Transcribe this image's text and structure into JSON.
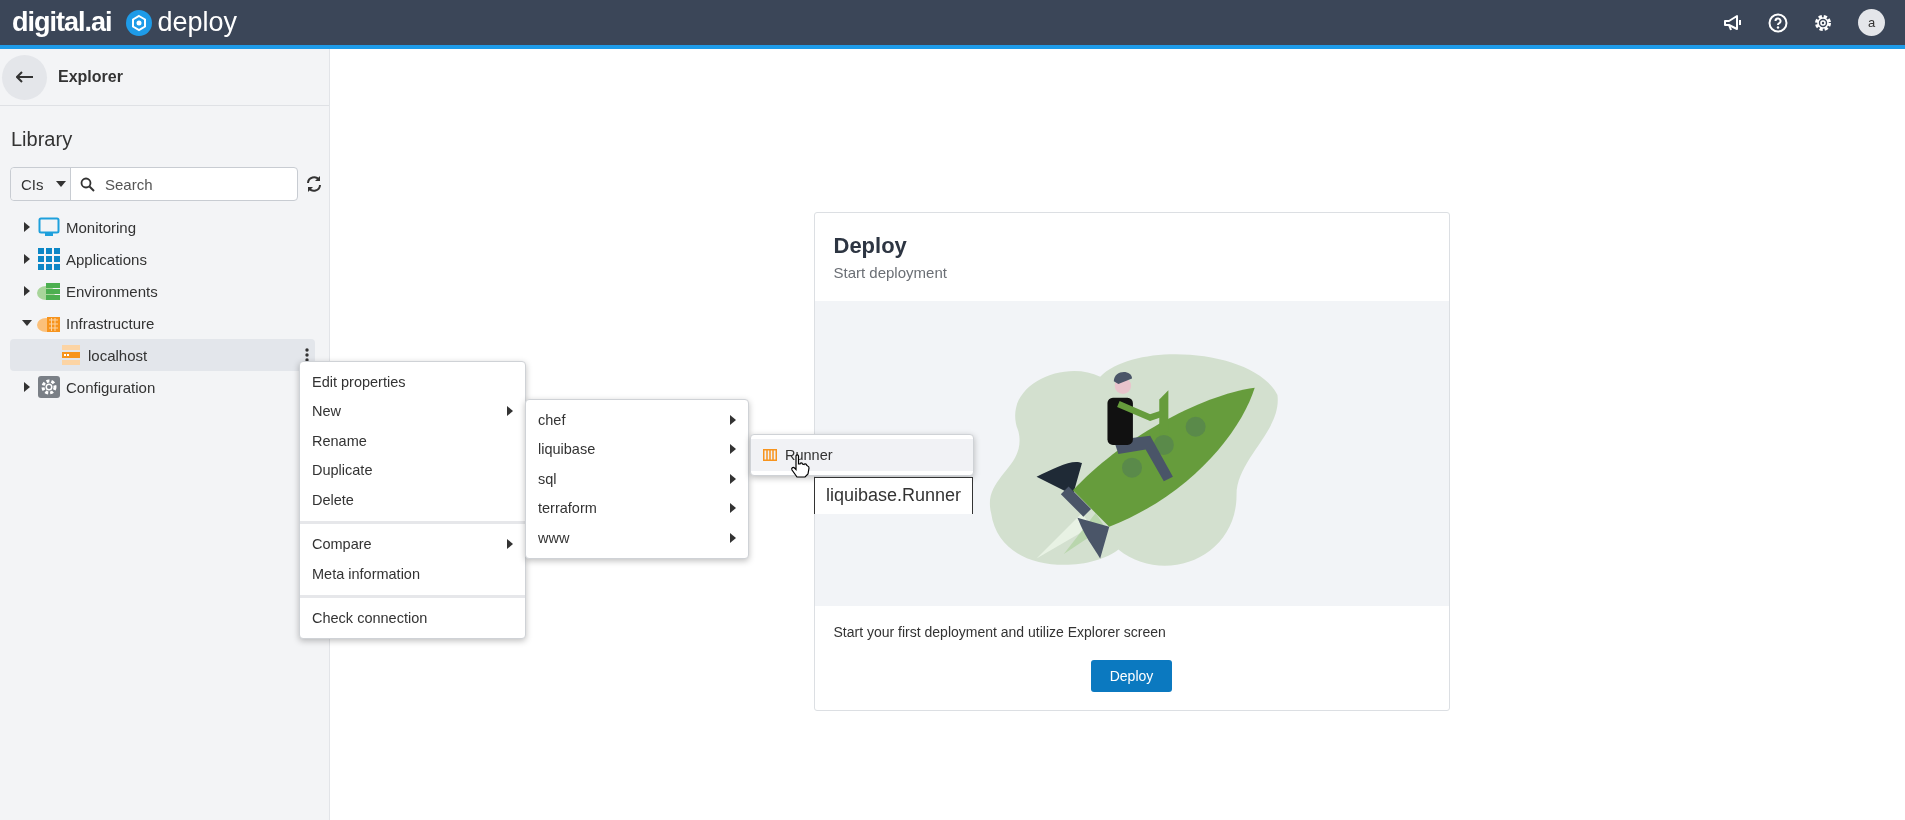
{
  "header": {
    "brand": "digital.ai",
    "product": "deploy",
    "avatar": "a"
  },
  "sidebar": {
    "title": "Explorer",
    "library_heading": "Library",
    "filter": {
      "value": "CIs"
    },
    "search": {
      "placeholder": "Search"
    },
    "tree": [
      {
        "label": "Monitoring",
        "kind": "monitor",
        "expanded": false,
        "selected": false
      },
      {
        "label": "Applications",
        "kind": "grid",
        "expanded": false,
        "selected": false
      },
      {
        "label": "Environments",
        "kind": "env",
        "expanded": false,
        "selected": false
      },
      {
        "label": "Infrastructure",
        "kind": "infra",
        "expanded": true,
        "selected": false,
        "children": [
          {
            "label": "localhost",
            "kind": "server",
            "selected": true
          }
        ]
      },
      {
        "label": "Configuration",
        "kind": "gear",
        "expanded": false,
        "selected": false
      }
    ]
  },
  "context_menu": {
    "groups": [
      [
        {
          "label": "Edit properties",
          "submenu": false
        },
        {
          "label": "New",
          "submenu": true
        },
        {
          "label": "Rename",
          "submenu": false
        },
        {
          "label": "Duplicate",
          "submenu": false
        },
        {
          "label": "Delete",
          "submenu": false
        }
      ],
      [
        {
          "label": "Compare",
          "submenu": true
        },
        {
          "label": "Meta information",
          "submenu": false
        }
      ],
      [
        {
          "label": "Check connection",
          "submenu": false
        }
      ]
    ]
  },
  "new_submenu": [
    {
      "label": "chef",
      "submenu": true
    },
    {
      "label": "liquibase",
      "submenu": true
    },
    {
      "label": "sql",
      "submenu": true
    },
    {
      "label": "terraform",
      "submenu": true
    },
    {
      "label": "www",
      "submenu": true
    }
  ],
  "liquibase_submenu": [
    {
      "label": "Runner",
      "selected": true
    }
  ],
  "tooltip": "liquibase.Runner",
  "card": {
    "title": "Deploy",
    "subtitle": "Start deployment",
    "description": "Start your first deployment and utilize Explorer screen",
    "button": "Deploy"
  }
}
